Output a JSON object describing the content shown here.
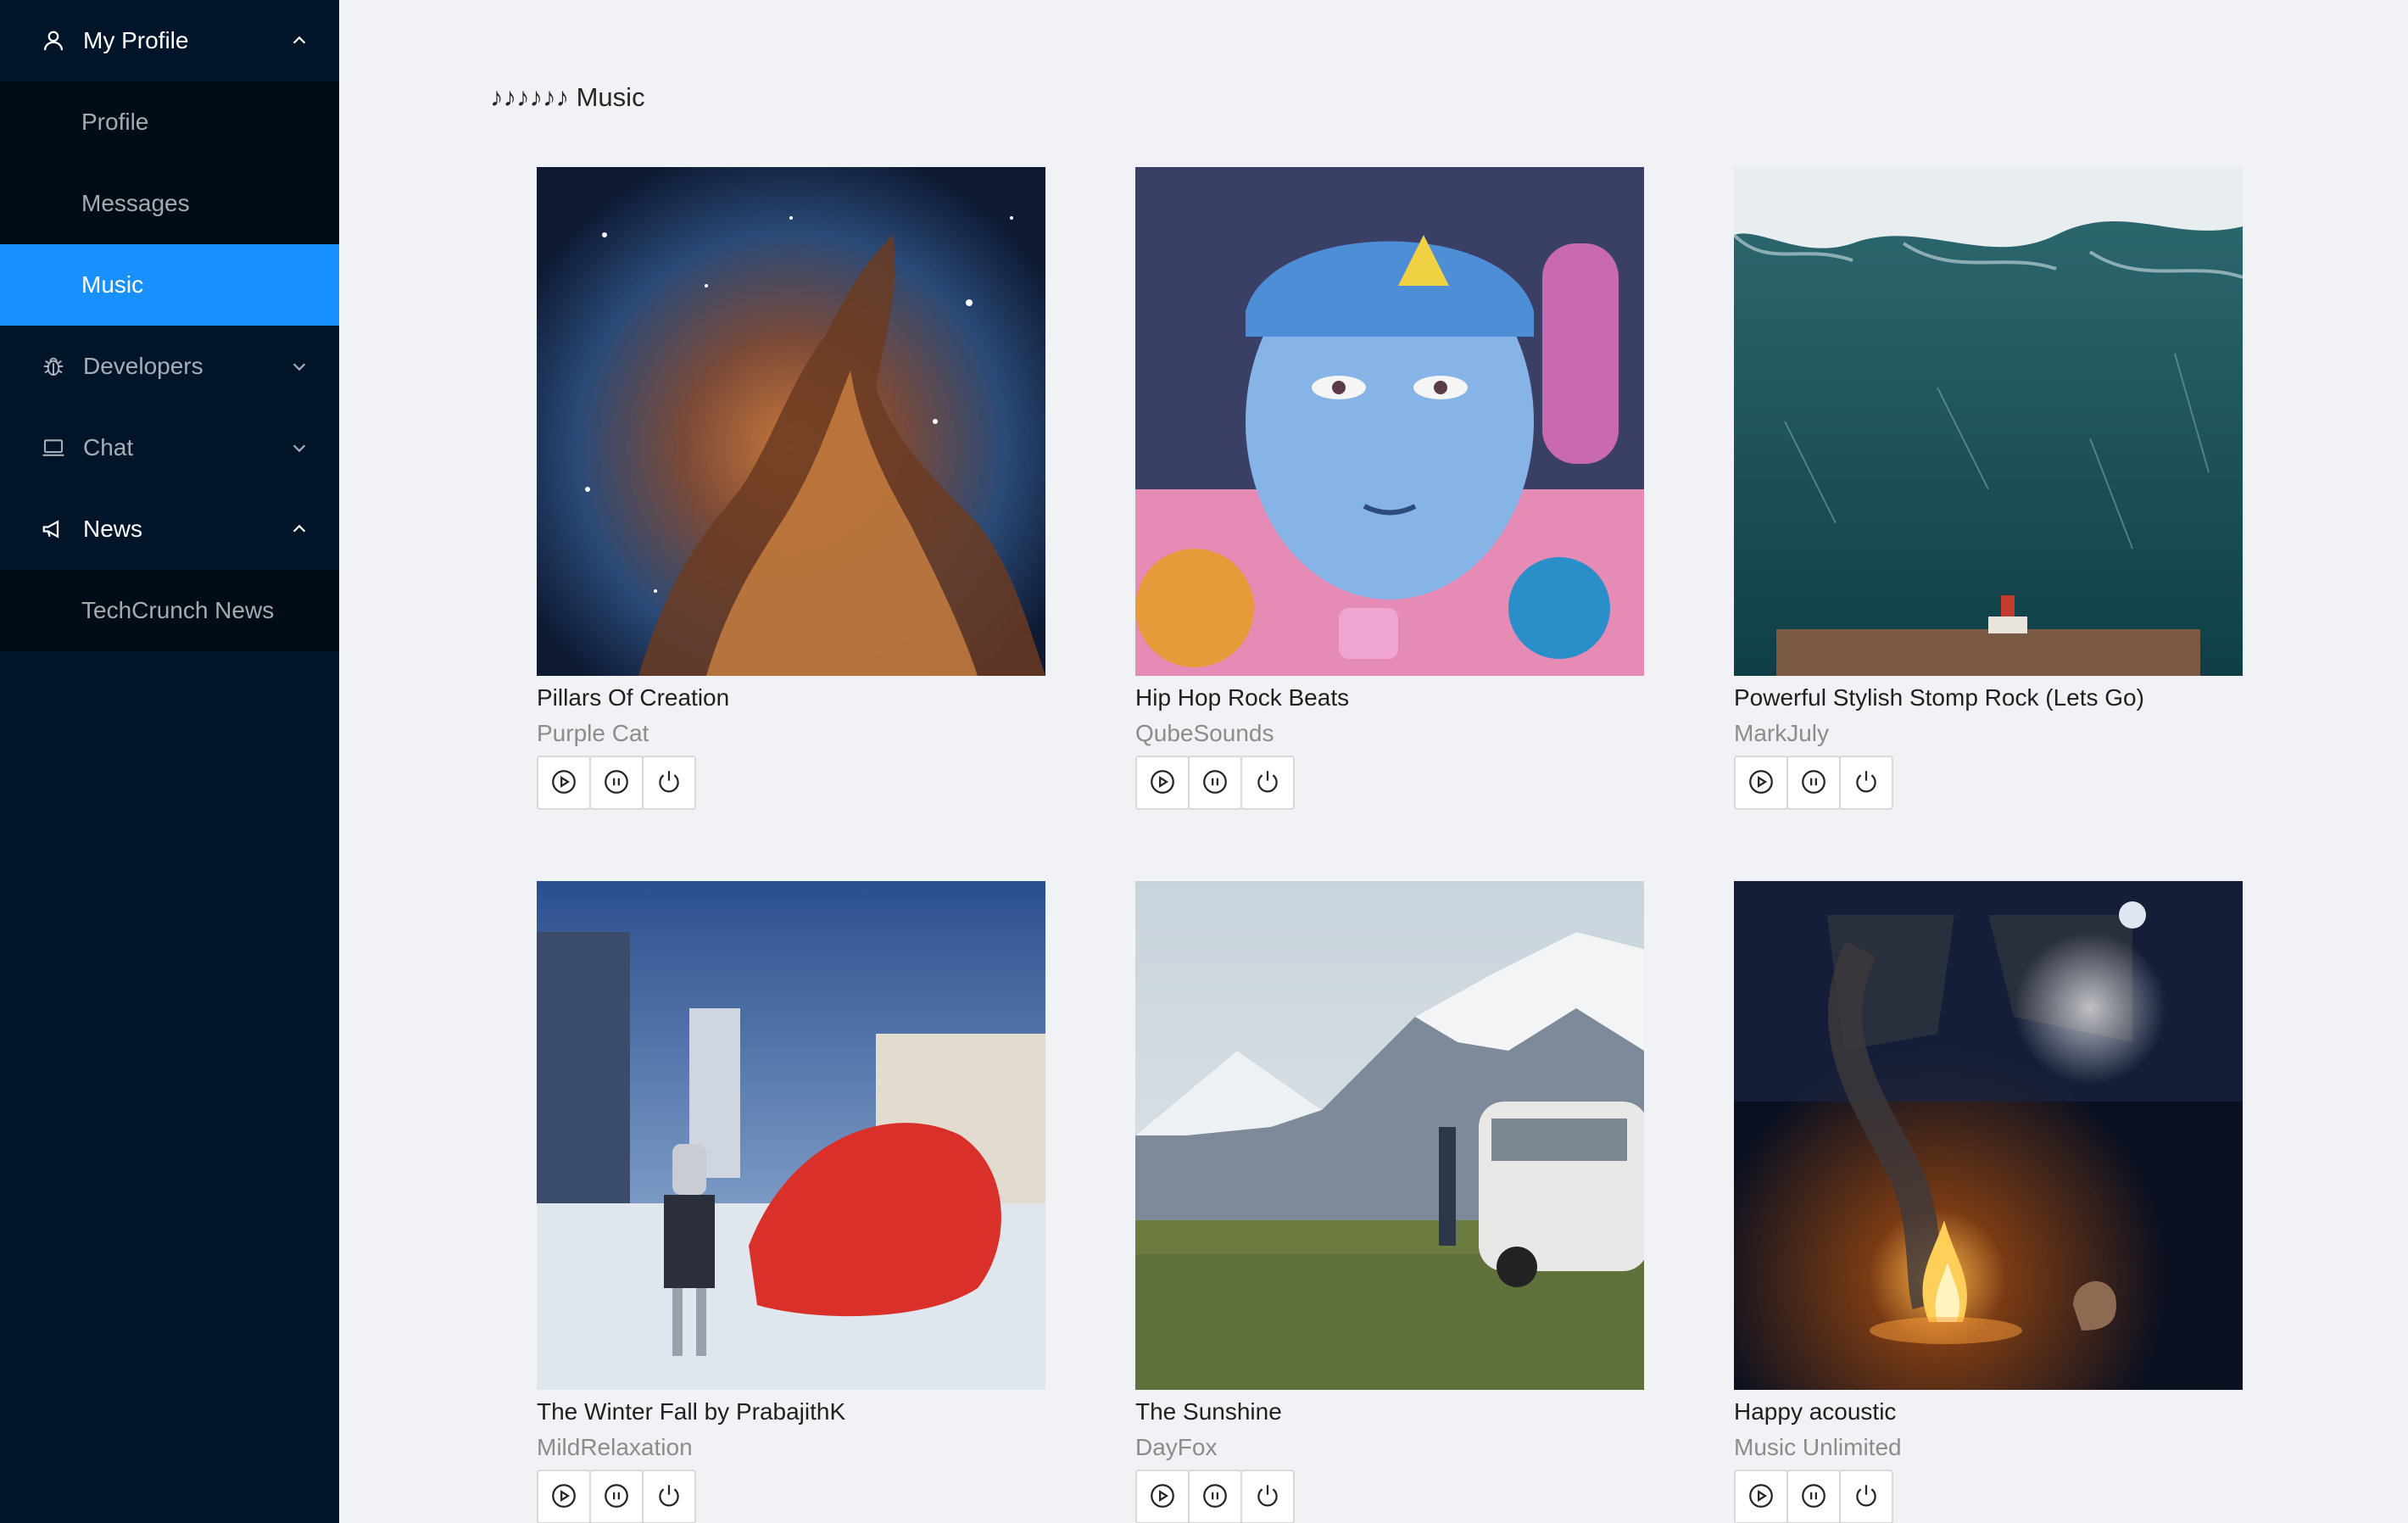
{
  "sidebar": {
    "groups": [
      {
        "label": "My Profile",
        "icon": "user-icon",
        "expanded": true,
        "items": [
          {
            "label": "Profile",
            "selected": false
          },
          {
            "label": "Messages",
            "selected": false
          },
          {
            "label": "Music",
            "selected": true
          }
        ]
      },
      {
        "label": "Developers",
        "icon": "bug-icon",
        "expanded": false,
        "items": []
      },
      {
        "label": "Chat",
        "icon": "laptop-icon",
        "expanded": false,
        "items": []
      },
      {
        "label": "News",
        "icon": "megaphone-icon",
        "expanded": true,
        "items": [
          {
            "label": "TechCrunch News",
            "selected": false
          }
        ]
      }
    ]
  },
  "page": {
    "title": "♪♪♪♪♪♪ Music"
  },
  "colors": {
    "sidebar_bg": "#001529",
    "submenu_bg": "#000c17",
    "selected_bg": "#1890ff",
    "content_bg": "#f0f2f5"
  },
  "songs": [
    {
      "title": "Pillars Of Creation",
      "artist": "Purple Cat",
      "cover_icon": "nebula-artwork"
    },
    {
      "title": "Hip Hop Rock Beats",
      "artist": "QubeSounds",
      "cover_icon": "cartoon-face-artwork"
    },
    {
      "title": "Powerful Stylish Stomp Rock (Lets Go)",
      "artist": "MarkJuly",
      "cover_icon": "giant-wave-artwork"
    },
    {
      "title": "The Winter Fall by PrabajithK",
      "artist": "MildRelaxation",
      "cover_icon": "robot-city-artwork"
    },
    {
      "title": "The Sunshine",
      "artist": "DayFox",
      "cover_icon": "mountain-van-artwork"
    },
    {
      "title": "Happy acoustic",
      "artist": "Music Unlimited",
      "cover_icon": "campfire-night-artwork"
    }
  ],
  "controls": [
    {
      "icon": "play-circle-icon"
    },
    {
      "icon": "pause-circle-icon"
    },
    {
      "icon": "power-icon"
    }
  ]
}
